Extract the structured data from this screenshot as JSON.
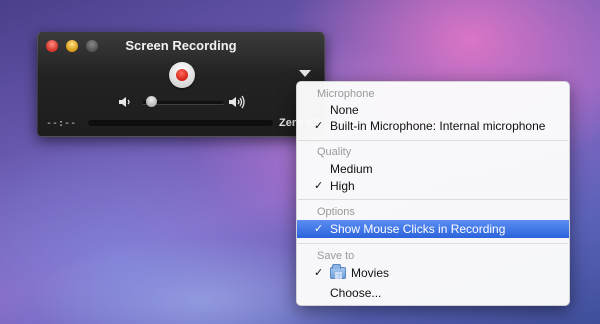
{
  "window": {
    "title": "Screen Recording",
    "elapsed_time": "--:--",
    "file_size": "Zero KB"
  },
  "icons": {
    "record": "record-icon",
    "options_menu": "triangle-down-icon",
    "volume_low": "speaker-low-icon",
    "volume_high": "speaker-high-icon",
    "folder": "movies-folder-icon"
  },
  "volume": {
    "level": 0.05
  },
  "menu": {
    "sections": {
      "microphone": {
        "header": "Microphone",
        "items": [
          {
            "label": "None",
            "checked": false
          },
          {
            "label": "Built-in Microphone: Internal microphone",
            "checked": true
          }
        ]
      },
      "quality": {
        "header": "Quality",
        "items": [
          {
            "label": "Medium",
            "checked": false
          },
          {
            "label": "High",
            "checked": true
          }
        ]
      },
      "options": {
        "header": "Options",
        "items": [
          {
            "label": "Show Mouse Clicks in Recording",
            "checked": true,
            "highlighted": true
          }
        ]
      },
      "save_to": {
        "header": "Save to",
        "items": [
          {
            "label": "Movies",
            "checked": true
          },
          {
            "label": "Choose...",
            "checked": false
          }
        ]
      }
    },
    "check_glyph": "✓"
  },
  "colors": {
    "highlight": "#2b63dc",
    "record_red": "#d41f14"
  }
}
